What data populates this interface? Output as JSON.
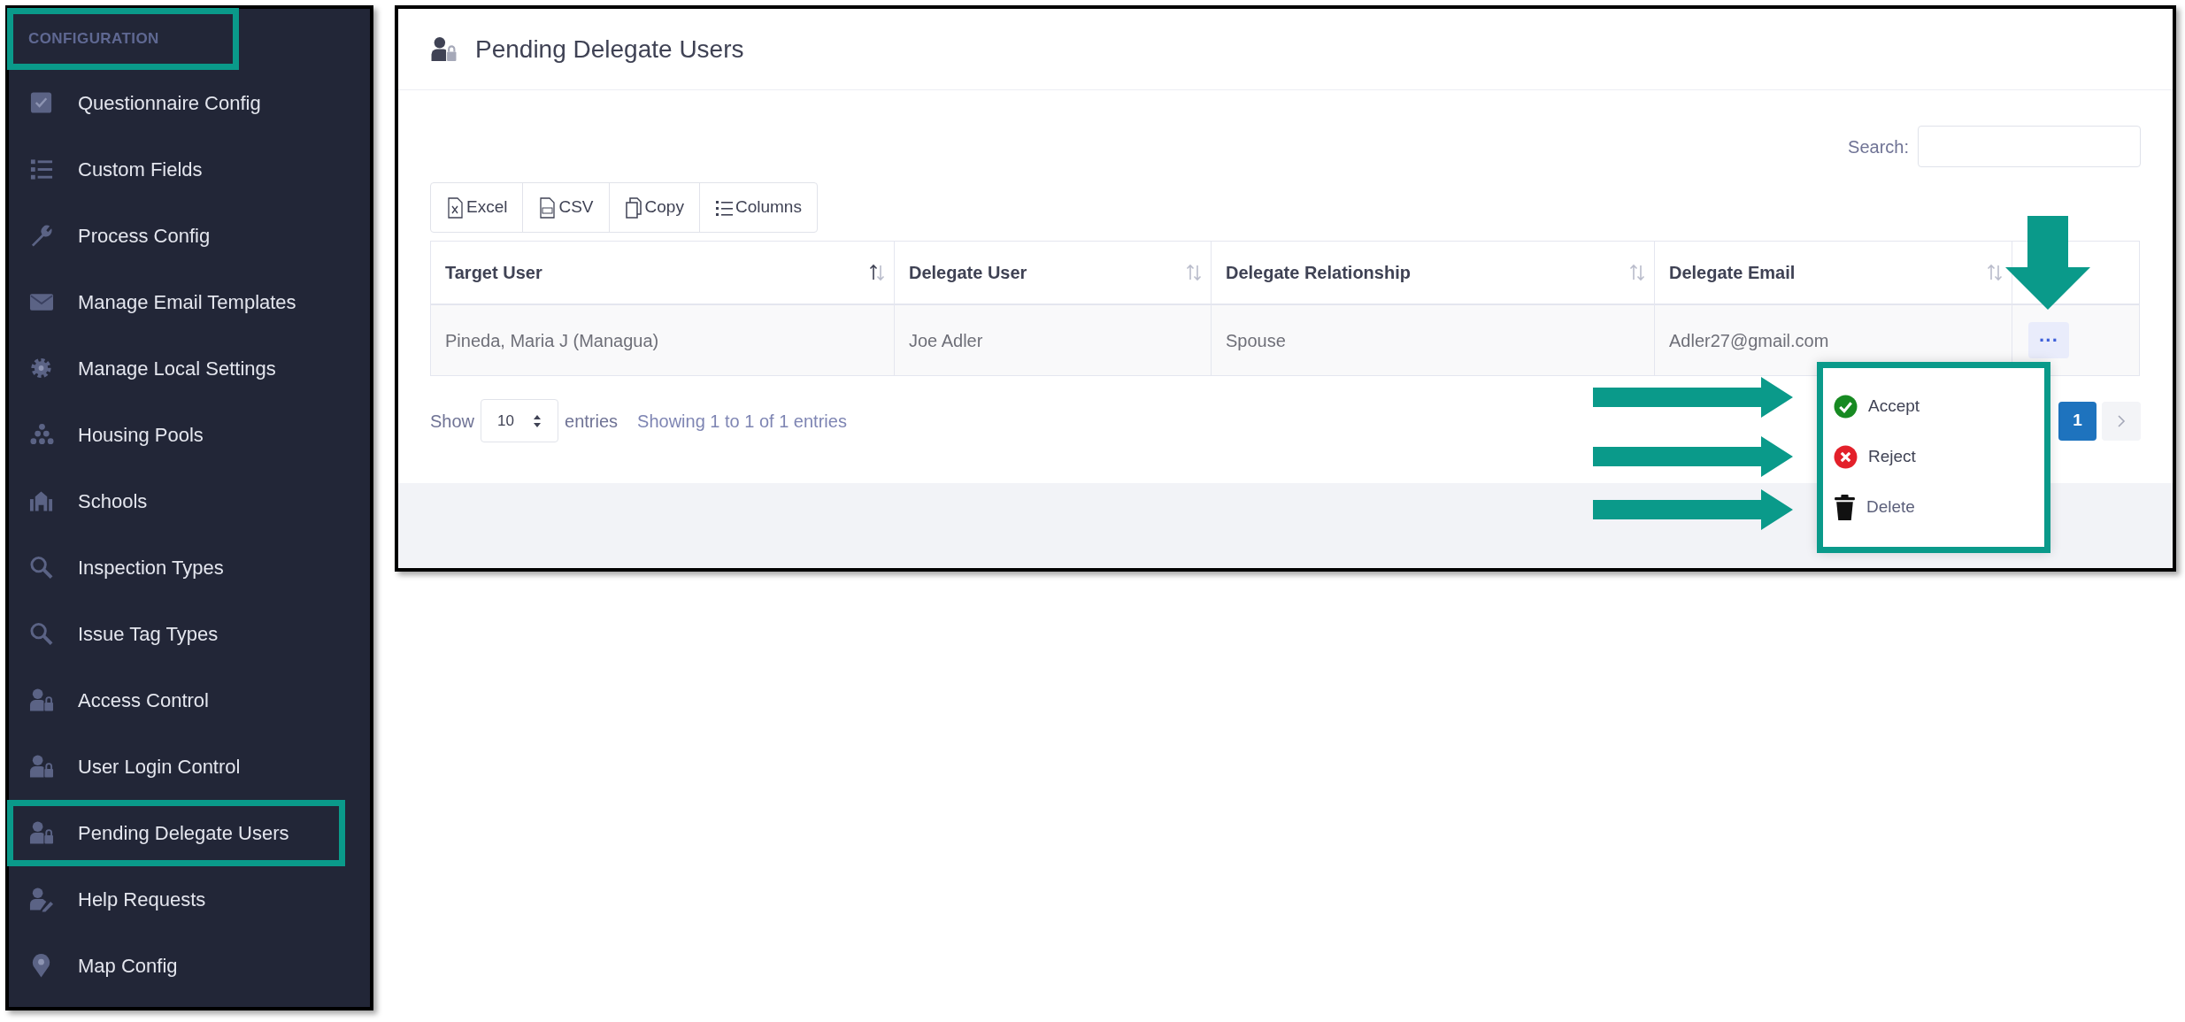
{
  "sidebar": {
    "section_title": "CONFIGURATION",
    "section_highlighted": true,
    "items": [
      {
        "label": "Questionnaire Config",
        "kind": "checkbox",
        "highlighted": false
      },
      {
        "label": "Custom Fields",
        "kind": "list",
        "highlighted": false
      },
      {
        "label": "Process Config",
        "kind": "wrench",
        "highlighted": false
      },
      {
        "label": "Manage Email Templates",
        "kind": "envelope",
        "highlighted": false
      },
      {
        "label": "Manage Local Settings",
        "kind": "gear",
        "highlighted": false
      },
      {
        "label": "Housing Pools",
        "kind": "dots",
        "highlighted": false
      },
      {
        "label": "Schools",
        "kind": "building",
        "highlighted": false
      },
      {
        "label": "Inspection Types",
        "kind": "search",
        "highlighted": false
      },
      {
        "label": "Issue Tag Types",
        "kind": "search",
        "highlighted": false
      },
      {
        "label": "Access Control",
        "kind": "userlock",
        "highlighted": false
      },
      {
        "label": "User Login Control",
        "kind": "userlock",
        "highlighted": false
      },
      {
        "label": "Pending Delegate Users",
        "kind": "userlock",
        "highlighted": true
      },
      {
        "label": "Help Requests",
        "kind": "useredit",
        "highlighted": false
      },
      {
        "label": "Map Config",
        "kind": "pin",
        "highlighted": false
      }
    ]
  },
  "page": {
    "title": "Pending Delegate Users"
  },
  "search": {
    "label": "Search:"
  },
  "toolbar": {
    "buttons": [
      {
        "label": "Excel",
        "kind": "excel"
      },
      {
        "label": "CSV",
        "kind": "csv"
      },
      {
        "label": "Copy",
        "kind": "copy"
      },
      {
        "label": "Columns",
        "kind": "columns"
      }
    ]
  },
  "table": {
    "columns": [
      {
        "label": "Target User",
        "sorted": true
      },
      {
        "label": "Delegate User",
        "sorted": false
      },
      {
        "label": "Delegate Relationship",
        "sorted": false
      },
      {
        "label": "Delegate Email",
        "sorted": false
      }
    ],
    "rows": [
      {
        "cells": [
          "Pineda, Maria J (Managua)",
          "Joe Adler",
          "Spouse",
          "Adler27@gmail.com"
        ],
        "action": "···"
      }
    ]
  },
  "footer": {
    "show_label": "Show",
    "page_size": "10",
    "entries_label": "entries",
    "info": "Showing 1 to 1 of 1 entries",
    "pages": [
      {
        "label": "1",
        "selected": true
      }
    ]
  },
  "row_menu": {
    "items": [
      {
        "label": "Accept",
        "kind": "accept"
      },
      {
        "label": "Reject",
        "kind": "reject"
      },
      {
        "label": "Delete",
        "kind": "delete"
      }
    ]
  }
}
